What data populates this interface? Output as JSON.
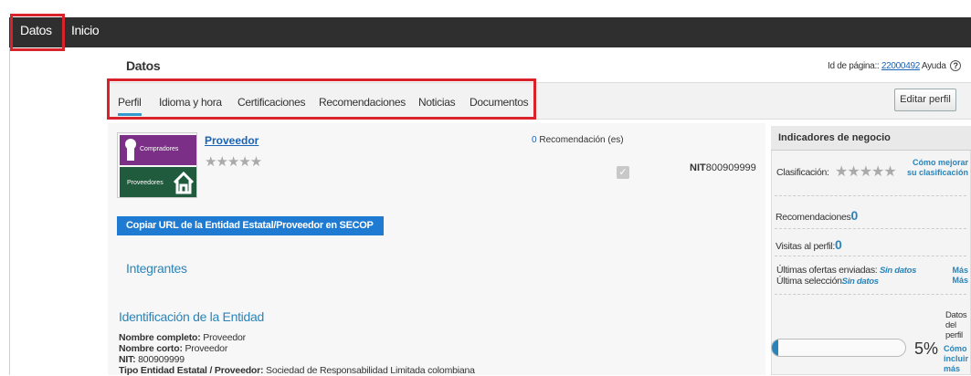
{
  "nav": {
    "tab_datos": "Datos",
    "tab_inicio": "Inicio"
  },
  "header": {
    "title": "Datos",
    "page_id_label": "Id de página::",
    "page_id": "22000492",
    "help": "Ayuda",
    "help_icon": "?"
  },
  "tabs": [
    {
      "label": "Perfil",
      "active": true
    },
    {
      "label": "Idioma y hora"
    },
    {
      "label": "Certificaciones"
    },
    {
      "label": "Recomendaciones"
    },
    {
      "label": "Noticias"
    },
    {
      "label": "Documentos"
    }
  ],
  "edit_button": "Editar perfil",
  "profile": {
    "logo_top_text": "Compradores",
    "logo_bottom_text": "Proveedores",
    "name_link": "Proveedor",
    "rating_stars": "★★★★★",
    "recommendations_count": "0",
    "recommendations_label": "Recomendación (es)",
    "nit_label": "NIT",
    "nit_value": "800909999"
  },
  "copy_url_button": "Copiar URL de la Entidad Estatal/Proveedor en SECOP",
  "sections": {
    "members_title": "Integrantes",
    "identification_title": "Identificación de la Entidad"
  },
  "identification": {
    "full_name_label": "Nombre completo:",
    "full_name": "Proveedor",
    "short_name_label": "Nombre corto:",
    "short_name": "Proveedor",
    "nit_label": "NIT:",
    "nit": "800909999",
    "type_label": "Tipo Entidad Estatal / Proveedor:",
    "type": "Sociedad de Responsabilidad Limitada colombiana"
  },
  "sidebar": {
    "title": "Indicadores de negocio",
    "classification_label": "Clasificación:",
    "classification_stars": "★★★★★",
    "improve_link": "Cómo mejorar su clasificación",
    "recommendations_label": "Recomendaciones",
    "recommendations_value": "0",
    "visits_label": "Visitas al perfil:",
    "visits_value": "0",
    "last_offers_label": "Últimas ofertas enviadas:",
    "last_offers_value": "Sin datos",
    "last_selection_label": "Última selección",
    "last_selection_value": "Sin datos",
    "more_1": "Más",
    "more_2": "Más",
    "profile_data_label": "Datos del perfil",
    "profile_percent": "5%",
    "profile_fraction": 0.05,
    "include_more_link": "Cómo incluir más"
  },
  "colors": {
    "topbar": "#2f2f2f",
    "accent": "#2a84b9",
    "highlight": "#d8232a",
    "button_blue": "#1f7ad1"
  }
}
